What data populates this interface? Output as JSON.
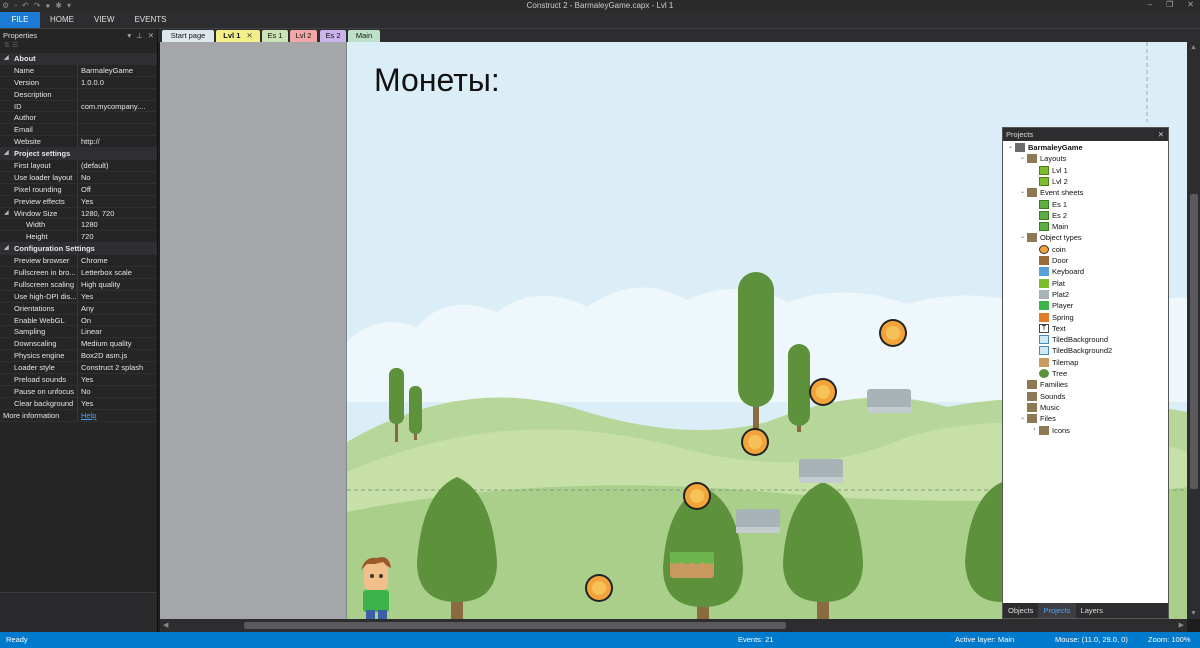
{
  "window": {
    "title": "Construct 2 - BarmaleyGame.capx - Lvl 1"
  },
  "ribbon": {
    "tabs": [
      "FILE",
      "HOME",
      "VIEW",
      "EVENTS"
    ]
  },
  "properties": {
    "title": "Properties",
    "rows": [
      {
        "type": "section",
        "name": "About"
      },
      {
        "type": "prop",
        "name": "Name",
        "value": "BarmaleyGame"
      },
      {
        "type": "prop",
        "name": "Version",
        "value": "1.0.0.0"
      },
      {
        "type": "prop",
        "name": "Description",
        "value": ""
      },
      {
        "type": "prop",
        "name": "ID",
        "value": "com.mycompany...."
      },
      {
        "type": "prop",
        "name": "Author",
        "value": ""
      },
      {
        "type": "prop",
        "name": "Email",
        "value": ""
      },
      {
        "type": "prop",
        "name": "Website",
        "value": "http://"
      },
      {
        "type": "section",
        "name": "Project settings"
      },
      {
        "type": "prop",
        "name": "First layout",
        "value": "(default)"
      },
      {
        "type": "prop",
        "name": "Use loader layout",
        "value": "No"
      },
      {
        "type": "prop",
        "name": "Pixel rounding",
        "value": "Off"
      },
      {
        "type": "prop",
        "name": "Preview effects",
        "value": "Yes"
      },
      {
        "type": "expand",
        "name": "Window Size",
        "value": "1280, 720"
      },
      {
        "type": "sub",
        "name": "Width",
        "value": "1280"
      },
      {
        "type": "sub",
        "name": "Height",
        "value": "720"
      },
      {
        "type": "section",
        "name": "Configuration Settings"
      },
      {
        "type": "prop",
        "name": "Preview browser",
        "value": "Chrome"
      },
      {
        "type": "prop",
        "name": "Fullscreen in bro...",
        "value": "Letterbox scale"
      },
      {
        "type": "prop",
        "name": "Fullscreen scaling",
        "value": "High quality"
      },
      {
        "type": "prop",
        "name": "Use high-DPI dis...",
        "value": "Yes"
      },
      {
        "type": "prop",
        "name": "Orientations",
        "value": "Any"
      },
      {
        "type": "prop",
        "name": "Enable WebGL",
        "value": "On"
      },
      {
        "type": "prop",
        "name": "Sampling",
        "value": "Linear"
      },
      {
        "type": "prop",
        "name": "Downscaling",
        "value": "Medium quality"
      },
      {
        "type": "prop",
        "name": "Physics engine",
        "value": "Box2D asm.js"
      },
      {
        "type": "prop",
        "name": "Loader style",
        "value": "Construct 2 splash"
      },
      {
        "type": "prop",
        "name": "Preload sounds",
        "value": "Yes"
      },
      {
        "type": "prop",
        "name": "Pause on unfocus",
        "value": "No"
      },
      {
        "type": "prop",
        "name": "Clear background",
        "value": "Yes"
      },
      {
        "type": "more",
        "name": "More information",
        "value": "Help"
      }
    ]
  },
  "doc_tabs": [
    {
      "label": "Start page",
      "color": "#dfe7ee"
    },
    {
      "label": "Lvl 1",
      "color": "#f5ef8a",
      "active": true,
      "close": "✕"
    },
    {
      "label": "Es 1",
      "color": "#c9e3b4"
    },
    {
      "label": "Lvl 2",
      "color": "#f2a6a6"
    },
    {
      "label": "Es 2",
      "color": "#c9b4ec"
    },
    {
      "label": "Main",
      "color": "#bfe0c8"
    }
  ],
  "layout": {
    "title_text": "Монеты:"
  },
  "projects": {
    "title": "Projects",
    "close": "✕",
    "tree": [
      {
        "label": "BarmaleyGame",
        "depth": 0,
        "icon": "root-icon",
        "open": true,
        "bold": true
      },
      {
        "label": "Layouts",
        "depth": 1,
        "icon": "folder-icon",
        "open": true
      },
      {
        "label": "Lvl 1",
        "depth": 2,
        "icon": "layout-icon"
      },
      {
        "label": "Lvl 2",
        "depth": 2,
        "icon": "layout-icon"
      },
      {
        "label": "Event sheets",
        "depth": 1,
        "icon": "folder-icon",
        "open": true
      },
      {
        "label": "Es 1",
        "depth": 2,
        "icon": "event-sheet-icon"
      },
      {
        "label": "Es 2",
        "depth": 2,
        "icon": "event-sheet-icon"
      },
      {
        "label": "Main",
        "depth": 2,
        "icon": "event-sheet-icon"
      },
      {
        "label": "Object types",
        "depth": 1,
        "icon": "folder-icon",
        "open": true
      },
      {
        "label": "coin",
        "depth": 2,
        "icon": "coin-icon"
      },
      {
        "label": "Door",
        "depth": 2,
        "icon": "door-icon"
      },
      {
        "label": "Keyboard",
        "depth": 2,
        "icon": "keyboard-icon"
      },
      {
        "label": "Plat",
        "depth": 2,
        "icon": "plat-icon"
      },
      {
        "label": "Plat2",
        "depth": 2,
        "icon": "plat2-icon"
      },
      {
        "label": "Player",
        "depth": 2,
        "icon": "player-icon"
      },
      {
        "label": "Spring",
        "depth": 2,
        "icon": "spring-icon"
      },
      {
        "label": "Text",
        "depth": 2,
        "icon": "text-icon"
      },
      {
        "label": "TiledBackground",
        "depth": 2,
        "icon": "tiled-background-icon"
      },
      {
        "label": "TiledBackground2",
        "depth": 2,
        "icon": "tiled-background-icon"
      },
      {
        "label": "Tilemap",
        "depth": 2,
        "icon": "tilemap-icon"
      },
      {
        "label": "Tree",
        "depth": 2,
        "icon": "tree-icon"
      },
      {
        "label": "Families",
        "depth": 1,
        "icon": "folder-icon"
      },
      {
        "label": "Sounds",
        "depth": 1,
        "icon": "folder-icon"
      },
      {
        "label": "Music",
        "depth": 1,
        "icon": "folder-icon"
      },
      {
        "label": "Files",
        "depth": 1,
        "icon": "folder-icon",
        "open": true
      },
      {
        "label": "Icons",
        "depth": 2,
        "icon": "folder-icon",
        "collapsed": true
      }
    ],
    "bottom_tabs": [
      {
        "label": "Objects"
      },
      {
        "label": "Projects",
        "active": true
      },
      {
        "label": "Layers"
      }
    ]
  },
  "status": {
    "ready": "Ready",
    "events": "Events: 21",
    "active_layer": "Active layer: Main",
    "mouse": "Mouse: (11.0, 29.0, 0)",
    "zoom": "Zoom: 100%"
  }
}
